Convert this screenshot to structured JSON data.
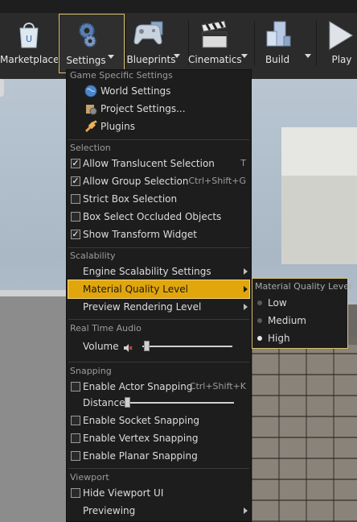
{
  "toolbar": {
    "buttons": [
      {
        "label": "Marketplace",
        "icon": "marketplace-bag-icon"
      },
      {
        "label": "Settings",
        "icon": "gear-settings-icon"
      },
      {
        "label": "Blueprints",
        "icon": "gamepad-icon"
      },
      {
        "label": "Cinematics",
        "icon": "clapperboard-icon"
      },
      {
        "label": "Build",
        "icon": "build-cubes-icon"
      },
      {
        "label": "Play",
        "icon": "play-icon"
      }
    ]
  },
  "menu": {
    "sections": {
      "game_specific": "Game Specific Settings",
      "selection": "Selection",
      "scalability": "Scalability",
      "audio": "Real Time Audio",
      "snapping": "Snapping",
      "viewport": "Viewport"
    },
    "game_items": [
      {
        "label": "World Settings",
        "icon": "globe-icon"
      },
      {
        "label": "Project Settings...",
        "icon": "project-settings-icon"
      },
      {
        "label": "Plugins",
        "icon": "plug-icon"
      }
    ],
    "selection_items": [
      {
        "label": "Allow Translucent Selection",
        "shortcut": "T",
        "checked": true
      },
      {
        "label": "Allow Group Selection",
        "shortcut": "Ctrl+Shift+G",
        "checked": true
      },
      {
        "label": "Strict Box Selection",
        "shortcut": "",
        "checked": false
      },
      {
        "label": "Box Select Occluded Objects",
        "shortcut": "",
        "checked": false
      },
      {
        "label": "Show Transform Widget",
        "shortcut": "",
        "checked": true
      }
    ],
    "scalability_items": [
      {
        "label": "Engine Scalability Settings"
      },
      {
        "label": "Material Quality Level"
      },
      {
        "label": "Preview Rendering Level"
      }
    ],
    "volume_label": "Volume",
    "volume_level": 0.0,
    "snapping_items": [
      {
        "label": "Enable Actor Snapping",
        "shortcut": "Ctrl+Shift+K",
        "checked": false
      }
    ],
    "distance_label": "Distance",
    "distance_level": 0.0,
    "snapping_more": [
      {
        "label": "Enable Socket Snapping",
        "checked": false
      },
      {
        "label": "Enable Vertex Snapping",
        "checked": false
      },
      {
        "label": "Enable Planar Snapping",
        "checked": false
      }
    ],
    "viewport_items": [
      {
        "label": "Hide Viewport UI",
        "checked": false
      },
      {
        "label": "Previewing"
      }
    ]
  },
  "submenu": {
    "title": "Material Quality Level",
    "options": [
      "Low",
      "Medium",
      "High"
    ],
    "selected": "High"
  },
  "colors": {
    "highlight": "#e0a60c",
    "menu_bg": "#1d1d1d",
    "toolbar_bg": "#2b2b2b"
  }
}
